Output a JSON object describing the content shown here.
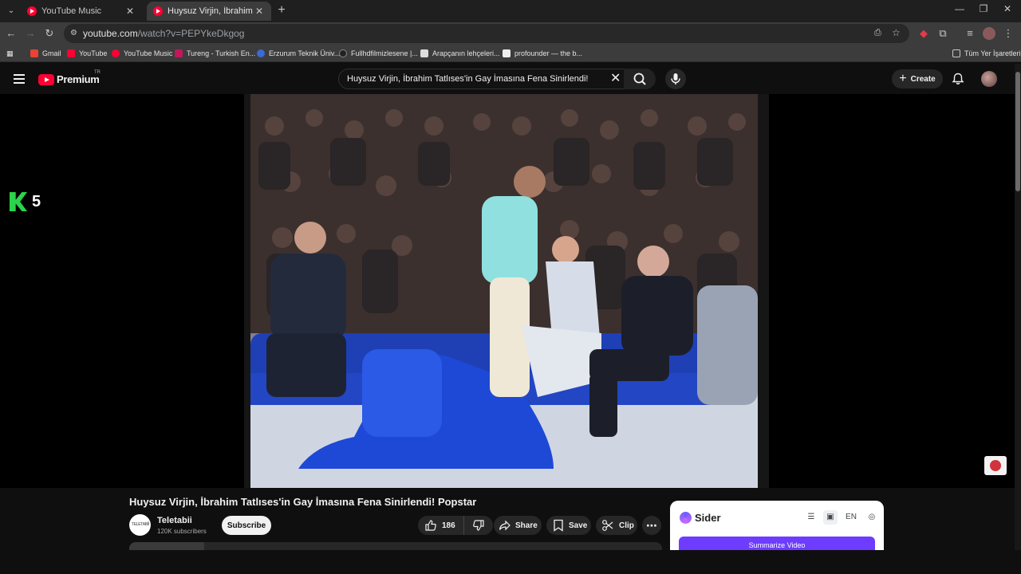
{
  "browser": {
    "tabs": [
      {
        "title": "YouTube Music",
        "active": false
      },
      {
        "title": "Huysuz Virjin, İbrahim Tatlıses'in Gay İmasına Fena Sinirlendi! Popstar",
        "active": true
      }
    ],
    "url_host": "youtube.com",
    "url_path": "/watch?v=PEPYkeDkgog",
    "bookmarks": [
      {
        "label": "Gmail",
        "color": "#ea4335"
      },
      {
        "label": "YouTube",
        "color": "#ff0033"
      },
      {
        "label": "YouTube Music",
        "color": "#ff0033"
      },
      {
        "label": "Tureng - Turkish En...",
        "color": "#c2185b"
      },
      {
        "label": "Erzurum Teknik Üniv...",
        "color": "#3a6ad6"
      },
      {
        "label": "Fullhdfilmizlesene |...",
        "color": "#222222"
      },
      {
        "label": "Arapçanın lehçeleri...",
        "color": "#dddddd"
      },
      {
        "label": "profounder — the b...",
        "color": "#eeeeee"
      }
    ],
    "all_bookmarks": "Tüm Yer İşaretleri"
  },
  "youtube": {
    "logo_text": "Premium",
    "region": "TR",
    "search_query": "Huysuz Virjin, İbrahim Tatlıses'in Gay İmasına Fena Sinirlendi!",
    "create_label": "Create",
    "channel_badge": "5"
  },
  "video": {
    "title": "Huysuz Virjin, İbrahim Tatlıses'in Gay İmasına Fena Sinirlendi! Popstar",
    "channel_name": "Teletabii",
    "channel_logo_text": "TELETABİİ",
    "subscribers": "120K subscribers",
    "subscribe_label": "Subscribe",
    "likes": "186",
    "share_label": "Share",
    "save_label": "Save",
    "clip_label": "Clip"
  },
  "sider": {
    "name": "Sider",
    "lang": "EN",
    "summarize_label": "Summarize Video"
  },
  "colors": {
    "youtube_red": "#ff0033",
    "k5_green": "#2bd44a",
    "sider_purple": "#6d3cff"
  }
}
